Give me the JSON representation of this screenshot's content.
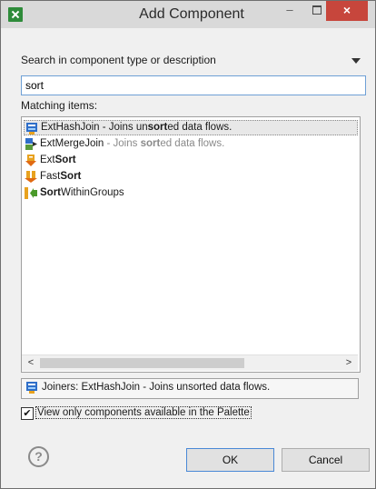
{
  "window": {
    "title": "Add Component",
    "minimize_glyph": "–",
    "close_glyph": "×"
  },
  "search": {
    "label": "Search in component type or description",
    "value": "sort"
  },
  "list": {
    "label": "Matching items:",
    "items": [
      {
        "icon": "joiner-icon",
        "pre": "ExtHashJoin - Joins un",
        "match": "sort",
        "post": "ed data flows.",
        "gray_desc": false,
        "selected": true
      },
      {
        "icon": "merge-join-icon",
        "pre": "ExtMergeJoin",
        "desc_pre": " - Joins ",
        "match": "sort",
        "post": "ed data flows.",
        "gray_desc": true,
        "selected": false
      },
      {
        "icon": "sort-icon",
        "pre": "Ext",
        "match": "Sort",
        "post": "",
        "gray_desc": false,
        "selected": false
      },
      {
        "icon": "sort-icon",
        "pre": "Fast",
        "match": "Sort",
        "post": "",
        "gray_desc": false,
        "selected": false
      },
      {
        "icon": "sort-within-groups-icon",
        "pre": "",
        "match": "Sort",
        "post": "WithinGroups",
        "gray_desc": false,
        "selected": false
      }
    ]
  },
  "info": {
    "text": "Joiners: ExtHashJoin - Joins unsorted data flows."
  },
  "checkbox": {
    "label": "View only components available in the Palette",
    "checked_glyph": "✔"
  },
  "buttons": {
    "help_glyph": "?",
    "ok": "OK",
    "cancel": "Cancel"
  },
  "colors": {
    "title_bar": "#d9d9d9",
    "close_red": "#c7463c",
    "input_border": "#6ea0d6"
  }
}
